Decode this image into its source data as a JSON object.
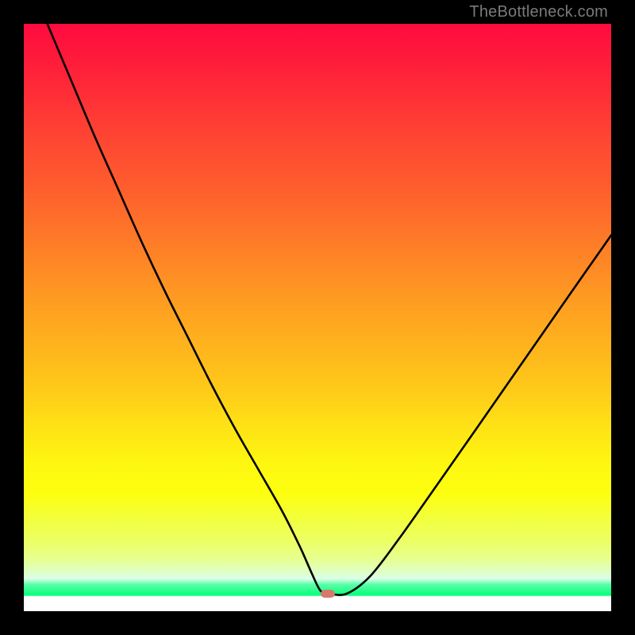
{
  "watermark": "TheBottleneck.com",
  "chart_data": {
    "type": "line",
    "title": "",
    "xlabel": "",
    "ylabel": "",
    "xlim": [
      0,
      100
    ],
    "ylim": [
      0,
      100
    ],
    "series": [
      {
        "name": "curve",
        "x": [
          4,
          8,
          12,
          16,
          20,
          24,
          28,
          32,
          36,
          40,
          44,
          47,
          49,
          50.5,
          52,
          55,
          59,
          64,
          70,
          77,
          85,
          93,
          100
        ],
        "y": [
          100,
          90.5,
          81,
          72,
          63,
          54.5,
          46.5,
          38.5,
          31,
          24,
          17,
          11,
          6.5,
          3.5,
          3,
          3,
          6,
          12.5,
          21,
          31,
          42.5,
          54,
          64
        ]
      }
    ],
    "marker": {
      "x": 51.8,
      "y": 3
    },
    "colors": {
      "curve": "#000000",
      "marker": "#D6796C",
      "frame": "#000000"
    }
  }
}
